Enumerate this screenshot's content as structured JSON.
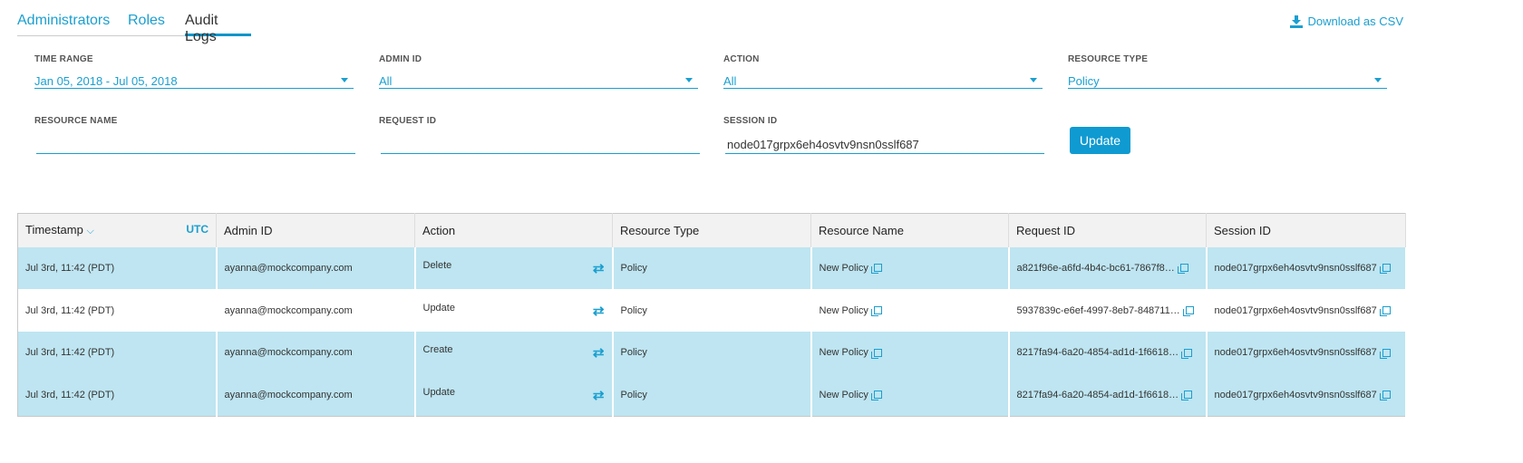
{
  "tabs": [
    "Administrators",
    "Roles",
    "Audit Logs"
  ],
  "download_label": "Download as CSV",
  "filters": {
    "time_range": {
      "label": "TIME RANGE",
      "value": "Jan 05, 2018 - Jul 05, 2018"
    },
    "admin_id": {
      "label": "ADMIN ID",
      "value": "All"
    },
    "action": {
      "label": "ACTION",
      "value": "All"
    },
    "resource_type": {
      "label": "RESOURCE TYPE",
      "value": "Policy"
    },
    "resource_name": {
      "label": "RESOURCE NAME",
      "value": ""
    },
    "request_id": {
      "label": "REQUEST ID",
      "value": ""
    },
    "session_id": {
      "label": "SESSION ID",
      "value": "node017grpx6eh4osvtv9nsn0sslf687"
    }
  },
  "update_label": "Update",
  "table": {
    "headers": {
      "timestamp": "Timestamp",
      "utc": "UTC",
      "admin": "Admin ID",
      "action": "Action",
      "rtype": "Resource Type",
      "rname": "Resource Name",
      "req": "Request ID",
      "sess": "Session ID"
    },
    "rows": [
      {
        "ts": "Jul 3rd, 11:42 (PDT)",
        "admin": "ayanna@mockcompany.com",
        "action": "Delete",
        "rtype": "Policy",
        "rname": "New Policy",
        "req": "a821f96e-a6fd-4b4c-bc61-7867f8…",
        "sess": "node017grpx6eh4osvtv9nsn0sslf687"
      },
      {
        "ts": "Jul 3rd, 11:42 (PDT)",
        "admin": "ayanna@mockcompany.com",
        "action": "Update",
        "rtype": "Policy",
        "rname": "New Policy",
        "req": "5937839c-e6ef-4997-8eb7-848711…",
        "sess": "node017grpx6eh4osvtv9nsn0sslf687"
      },
      {
        "ts": "Jul 3rd, 11:42 (PDT)",
        "admin": "ayanna@mockcompany.com",
        "action": "Create",
        "rtype": "Policy",
        "rname": "New Policy",
        "req": "8217fa94-6a20-4854-ad1d-1f6618…",
        "sess": "node017grpx6eh4osvtv9nsn0sslf687"
      },
      {
        "ts": "Jul 3rd, 11:42 (PDT)",
        "admin": "ayanna@mockcompany.com",
        "action": "Update",
        "rtype": "Policy",
        "rname": "New Policy",
        "req": "8217fa94-6a20-4854-ad1d-1f6618…",
        "sess": "node017grpx6eh4osvtv9nsn0sslf687"
      }
    ]
  }
}
